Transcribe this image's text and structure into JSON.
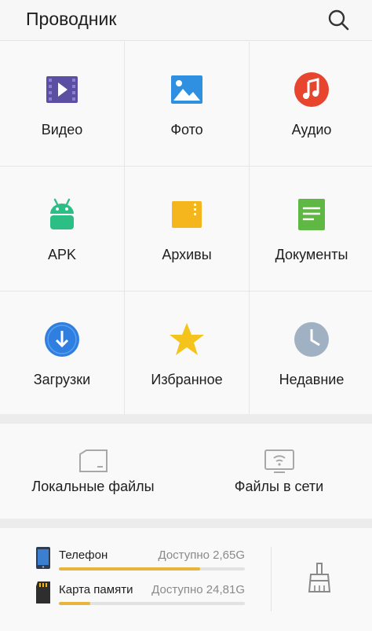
{
  "header": {
    "title": "Проводник",
    "search_icon": "search-icon"
  },
  "categories": [
    {
      "label": "Видео",
      "icon": "video-icon",
      "color": "#5b4fa3"
    },
    {
      "label": "Фото",
      "icon": "photo-icon",
      "color": "#2f8fe0"
    },
    {
      "label": "Аудио",
      "icon": "audio-icon",
      "color": "#e8452f"
    },
    {
      "label": "APK",
      "icon": "android-icon",
      "color": "#2bbf86"
    },
    {
      "label": "Архивы",
      "icon": "archive-icon",
      "color": "#f4b61c"
    },
    {
      "label": "Документы",
      "icon": "document-icon",
      "color": "#5fb843"
    },
    {
      "label": "Загрузки",
      "icon": "download-icon",
      "color": "#2f7fe0"
    },
    {
      "label": "Избранное",
      "icon": "star-icon",
      "color": "#f4c31c"
    },
    {
      "label": "Недавние",
      "icon": "clock-icon",
      "color": "#9fb1c2"
    }
  ],
  "locations": [
    {
      "label": "Локальные файлы",
      "icon": "local-drive-icon"
    },
    {
      "label": "Файлы в сети",
      "icon": "network-icon"
    }
  ],
  "storage": [
    {
      "name": "Телефон",
      "available": "Доступно 2,65G",
      "used_fraction": 0.76,
      "icon": "phone-icon"
    },
    {
      "name": "Карта памяти",
      "available": "Доступно 24,81G",
      "used_fraction": 0.17,
      "icon": "sd-card-icon"
    }
  ],
  "cleaner_icon": "broom-icon",
  "accent_color": "#e8b53a"
}
